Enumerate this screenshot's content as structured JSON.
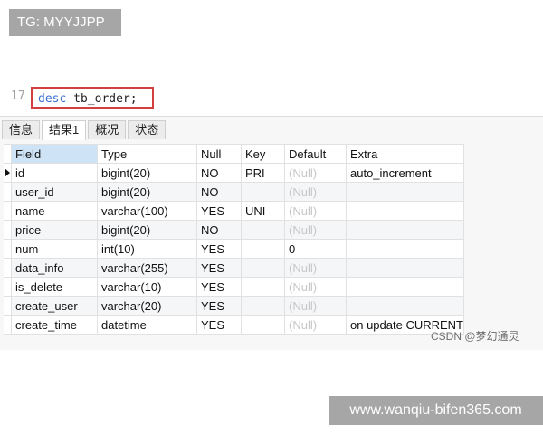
{
  "top_tag": {
    "text": "TG: MYYJJPP"
  },
  "editor": {
    "line_number": "17",
    "keyword": "desc",
    "table_name": "tb_order;"
  },
  "result_tabs": [
    {
      "label": "信息",
      "active": false
    },
    {
      "label": "结果1",
      "active": true
    },
    {
      "label": "概况",
      "active": false
    },
    {
      "label": "状态",
      "active": false
    }
  ],
  "table": {
    "columns": [
      "Field",
      "Type",
      "Null",
      "Key",
      "Default",
      "Extra"
    ],
    "rows": [
      {
        "field": "id",
        "type": "bigint(20)",
        "null": "NO",
        "key": "PRI",
        "default": "(Null)",
        "extra": "auto_increment"
      },
      {
        "field": "user_id",
        "type": "bigint(20)",
        "null": "NO",
        "key": "",
        "default": "(Null)",
        "extra": ""
      },
      {
        "field": "name",
        "type": "varchar(100)",
        "null": "YES",
        "key": "UNI",
        "default": "(Null)",
        "extra": ""
      },
      {
        "field": "price",
        "type": "bigint(20)",
        "null": "NO",
        "key": "",
        "default": "(Null)",
        "extra": ""
      },
      {
        "field": "num",
        "type": "int(10)",
        "null": "YES",
        "key": "",
        "default": "0",
        "extra": ""
      },
      {
        "field": "data_info",
        "type": "varchar(255)",
        "null": "YES",
        "key": "",
        "default": "(Null)",
        "extra": ""
      },
      {
        "field": "is_delete",
        "type": "varchar(10)",
        "null": "YES",
        "key": "",
        "default": "(Null)",
        "extra": ""
      },
      {
        "field": "create_user",
        "type": "varchar(20)",
        "null": "YES",
        "key": "",
        "default": "(Null)",
        "extra": ""
      },
      {
        "field": "create_time",
        "type": "datetime",
        "null": "YES",
        "key": "",
        "default": "(Null)",
        "extra": "on update CURRENT"
      }
    ]
  },
  "watermark_csdn": "CSDN @梦幻通灵",
  "watermark_site": "www.wanqiu-bifen365.com",
  "colors": {
    "highlight_box": "#d1403f",
    "keyword": "#3b6fcf",
    "header_selected": "#cfe3f7",
    "null_text": "#c7c7c7"
  }
}
